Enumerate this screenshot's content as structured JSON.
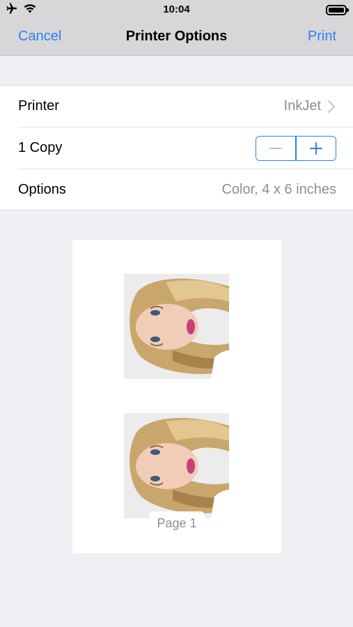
{
  "status_bar": {
    "time": "10:04",
    "icons": [
      "airplane-icon",
      "wifi-icon",
      "battery-icon"
    ]
  },
  "nav": {
    "cancel_label": "Cancel",
    "title": "Printer Options",
    "print_label": "Print"
  },
  "settings": {
    "printer": {
      "label": "Printer",
      "value": "InkJet"
    },
    "copies": {
      "label": "1 Copy",
      "decrement_icon": "minus-icon",
      "increment_icon": "plus-icon"
    },
    "options": {
      "label": "Options",
      "value": "Color, 4 x 6 inches"
    }
  },
  "preview": {
    "page_label": "Page 1",
    "photos": [
      {
        "description": "portrait photo",
        "orientation": "rotated"
      },
      {
        "description": "portrait photo",
        "orientation": "rotated"
      }
    ]
  },
  "colors": {
    "accent": "#2f7ef0",
    "header_bg": "#d7d7d9",
    "screen_bg": "#efeff4",
    "secondary_text": "#8e8e93"
  }
}
